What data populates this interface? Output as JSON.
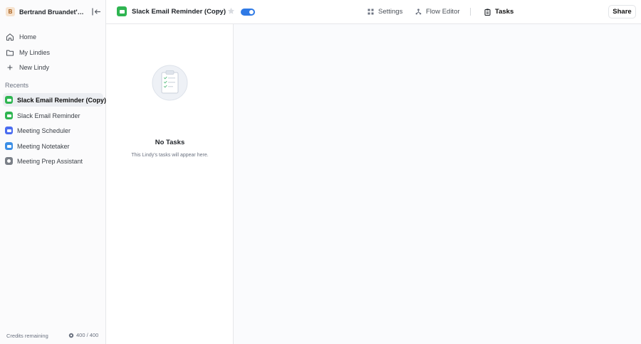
{
  "sidebar": {
    "workspace": {
      "initial": "B",
      "name": "Bertrand Bruandet's..."
    },
    "nav": [
      {
        "label": "Home",
        "icon": "home-icon"
      },
      {
        "label": "My Lindies",
        "icon": "folder-icon"
      },
      {
        "label": "New Lindy",
        "icon": "plus-icon"
      }
    ],
    "recents_heading": "Recents",
    "recents": [
      {
        "label": "Slack Email Reminder (Copy)",
        "color": "#2fb551",
        "active": true
      },
      {
        "label": "Slack Email Reminder",
        "color": "#2fb551",
        "active": false
      },
      {
        "label": "Meeting Scheduler",
        "color": "#4a6cf0",
        "active": false
      },
      {
        "label": "Meeting Notetaker",
        "color": "#3b8ee6",
        "active": false
      },
      {
        "label": "Meeting Prep Assistant",
        "color": "#7a7f87",
        "active": false
      }
    ],
    "credits_label": "Credits remaining",
    "credits_value": "400 / 400"
  },
  "header": {
    "title": "Slack Email Reminder (Copy)",
    "enabled": true,
    "tabs": [
      {
        "label": "Settings",
        "icon": "settings-grid-icon",
        "active": false
      },
      {
        "label": "Flow Editor",
        "icon": "flow-icon",
        "active": false
      },
      {
        "label": "Tasks",
        "icon": "clipboard-icon",
        "active": true
      }
    ],
    "share_label": "Share"
  },
  "tasks": {
    "empty_title": "No Tasks",
    "empty_subtitle": "This Lindy's tasks will appear here."
  }
}
